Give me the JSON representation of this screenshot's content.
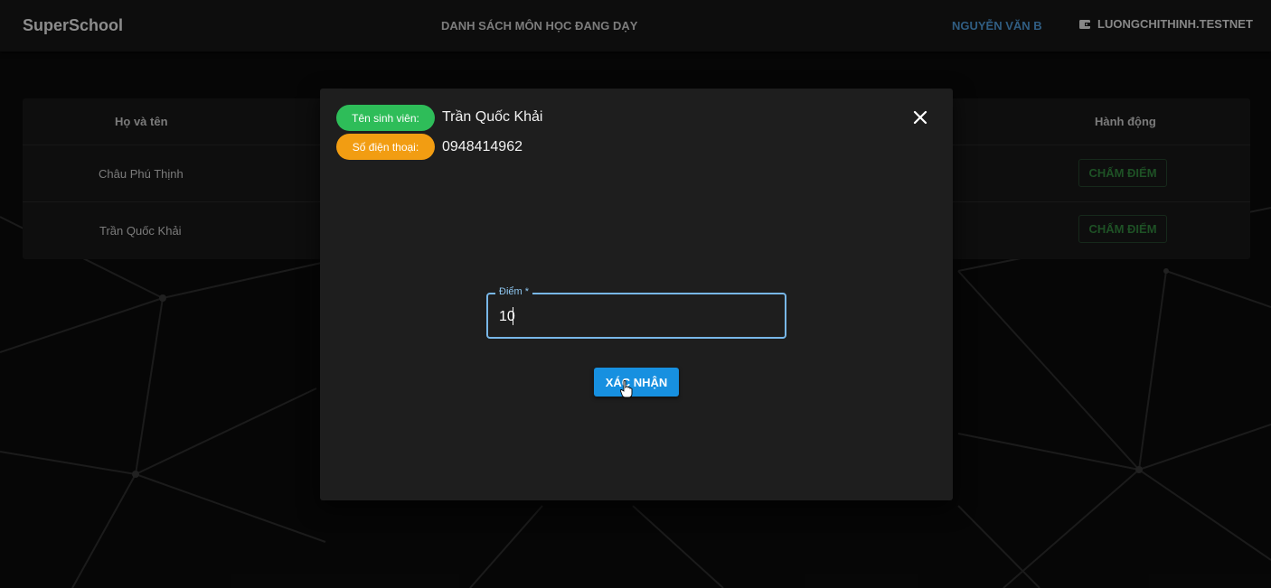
{
  "header": {
    "brand": "SuperSchool",
    "title": "DANH SÁCH MÔN HỌC ĐANG DẠY",
    "user": "NGUYỄN VĂN B",
    "wallet": "LUONGCHITHINH.TESTNET"
  },
  "table": {
    "columns": [
      "Họ và tên",
      "Hành động"
    ],
    "rows": [
      {
        "name": "Châu Phú Thịnh",
        "action": "CHẤM ĐIỂM"
      },
      {
        "name": "Trần Quốc Khải",
        "action": "CHẤM ĐIỂM"
      }
    ]
  },
  "modal": {
    "student_label": "Tên sinh viên:",
    "student_name": "Trần Quốc Khải",
    "phone_label": "Số điện thoại:",
    "phone": "0948414962",
    "score_label": "Điểm *",
    "score_value": "10",
    "confirm": "XÁC NHẬN"
  },
  "colors": {
    "background": "#0a0a0a",
    "modal": "#1e1e1e",
    "green_pill": "#2ebd59",
    "orange_pill": "#f29d12",
    "primary": "#1790e0",
    "user_link": "#4a90c8",
    "grade_button": "#2e7d3a"
  },
  "icons": {
    "close": "close-icon",
    "wallet": "wallet-icon",
    "cursor": "hand-pointer-cursor"
  }
}
